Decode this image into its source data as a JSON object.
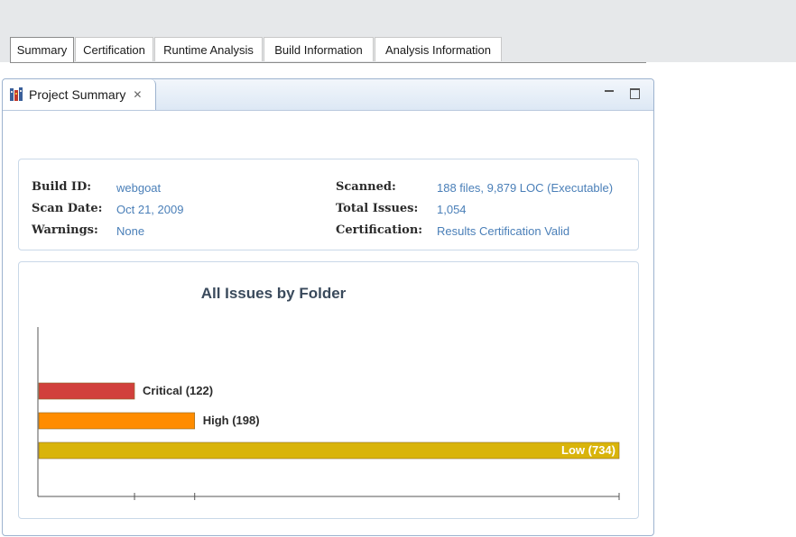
{
  "view": {
    "title": "Project Summary",
    "tabs": [
      "Summary",
      "Certification",
      "Runtime Analysis",
      "Build Information",
      "Analysis Information"
    ],
    "active_tab": "Summary"
  },
  "summary": {
    "build_id_label": "Build ID:",
    "build_id": "webgoat",
    "scan_date_label": "Scan Date:",
    "scan_date": "Oct 21, 2009",
    "warnings_label": "Warnings:",
    "warnings": "None",
    "scanned_label": "Scanned:",
    "scanned": "188 files, 9,879 LOC (Executable)",
    "total_issues_label": "Total Issues:",
    "total_issues": "1,054",
    "certification_label": "Certification:",
    "certification": "Results Certification Valid"
  },
  "colors": {
    "critical": "#d1403c",
    "high": "#ff8c00",
    "low": "#d9b40a",
    "link": "#4a7fb8"
  },
  "chart_data": {
    "type": "bar",
    "orientation": "horizontal",
    "title": "All Issues by Folder",
    "categories": [
      "Critical",
      "High",
      "Low"
    ],
    "labels": [
      "Critical (122)",
      "High (198)",
      "Low (734)"
    ],
    "values": [
      122,
      198,
      734
    ],
    "xlim": [
      0,
      734
    ],
    "grid": false
  }
}
